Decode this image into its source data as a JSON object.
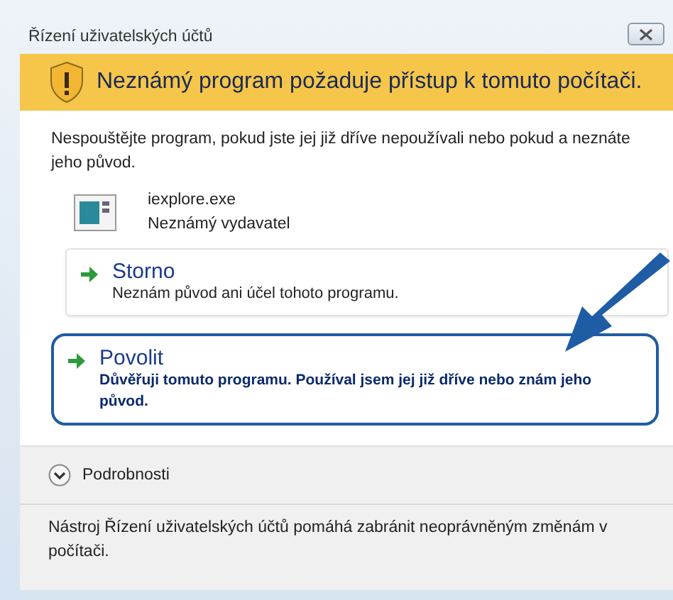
{
  "window": {
    "title": "Řízení uživatelských účtů"
  },
  "banner": {
    "text": "Neznámý program požaduje přístup k tomuto počítači."
  },
  "message": "Nespouštějte program, pokud jste jej již dříve nepoužívali nebo pokud a neznáte jeho původ.",
  "program": {
    "name": "iexplore.exe",
    "publisher": "Neznámý vydavatel"
  },
  "options": [
    {
      "title": "Storno",
      "description": "Neznám původ ani účel tohoto programu.",
      "highlighted": false
    },
    {
      "title": "Povolit",
      "description": "Důvěřuji tomuto programu. Používal jsem jej již dříve nebo znám jeho původ.",
      "highlighted": true
    }
  ],
  "details": {
    "label": "Podrobnosti",
    "expanded": false
  },
  "footer": "Nástroj Řízení uživatelských účtů pomáhá zabránit neoprávněným změnám v počítači."
}
